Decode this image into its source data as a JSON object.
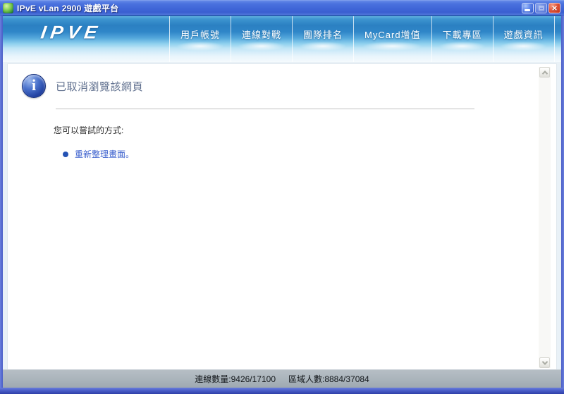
{
  "window": {
    "title": "IPvE vLan 2900 遊戲平台",
    "controls": {
      "minimize": "minimize",
      "maximize": "maximize",
      "close": "close"
    }
  },
  "navbar": {
    "logo": "IPVE",
    "items": [
      {
        "label": "用戶帳號"
      },
      {
        "label": "連線對戰"
      },
      {
        "label": "團隊排名"
      },
      {
        "label": "MyCard增值"
      },
      {
        "label": "下載專區"
      },
      {
        "label": "遊戲資訊"
      }
    ]
  },
  "content": {
    "error_title": "已取消瀏覽該網頁",
    "try_label": "您可以嘗試的方式:",
    "suggestions": [
      {
        "label": "重新整理畫面。"
      }
    ]
  },
  "statusbar": {
    "connections_label": "連線數量:9426/17100",
    "region_label": "區域人數:8884/37084"
  },
  "colors": {
    "titlebar_blue": "#4a72de",
    "nav_blue": "#2e86c8",
    "frame_blue": "#5468d0",
    "heading_slate": "#61718f",
    "link_blue": "#3a5fcd",
    "bullet_blue": "#2452b4",
    "status_gray": "#abb5bc",
    "close_red": "#d0482e"
  }
}
